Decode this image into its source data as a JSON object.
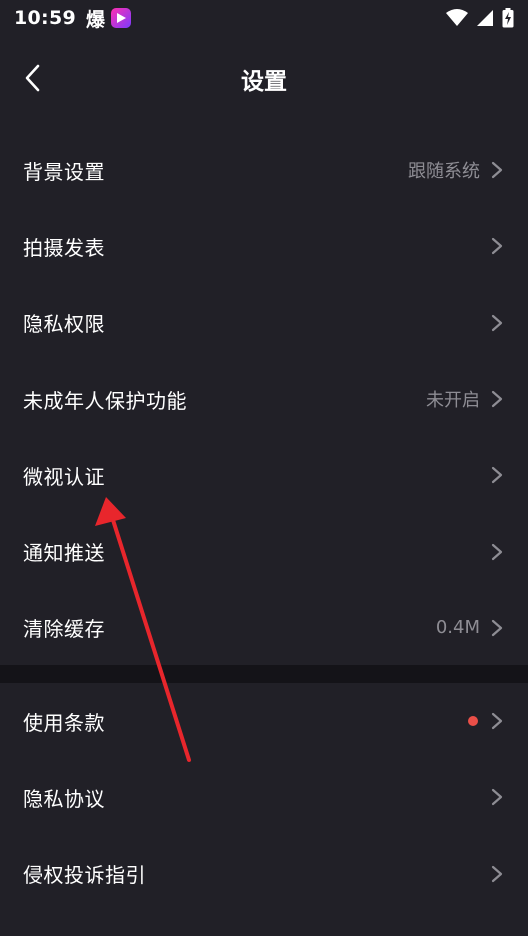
{
  "status_bar": {
    "time": "10:59",
    "icon_glyph": "爆",
    "icons": [
      "app-badge-icon",
      "wifi-icon",
      "signal-icon",
      "battery-charging-icon"
    ]
  },
  "header": {
    "title": "设置",
    "back_icon": "chevron-left-icon"
  },
  "settings_group_1": [
    {
      "label": "背景设置",
      "value": "跟随系统"
    },
    {
      "label": "拍摄发表",
      "value": ""
    },
    {
      "label": "隐私权限",
      "value": ""
    },
    {
      "label": "未成年人保护功能",
      "value": "未开启"
    },
    {
      "label": "微视认证",
      "value": ""
    },
    {
      "label": "通知推送",
      "value": ""
    },
    {
      "label": "清除缓存",
      "value": "0.4M"
    }
  ],
  "settings_group_2": [
    {
      "label": "使用条款",
      "value": "",
      "badge": "red-dot"
    },
    {
      "label": "隐私协议",
      "value": ""
    },
    {
      "label": "侵权投诉指引",
      "value": ""
    }
  ],
  "colors": {
    "background": "#212027",
    "divider": "#141318",
    "secondary_text": "#8e8d94",
    "badge": "#ea4f48",
    "annotation_arrow": "#e8262c"
  }
}
